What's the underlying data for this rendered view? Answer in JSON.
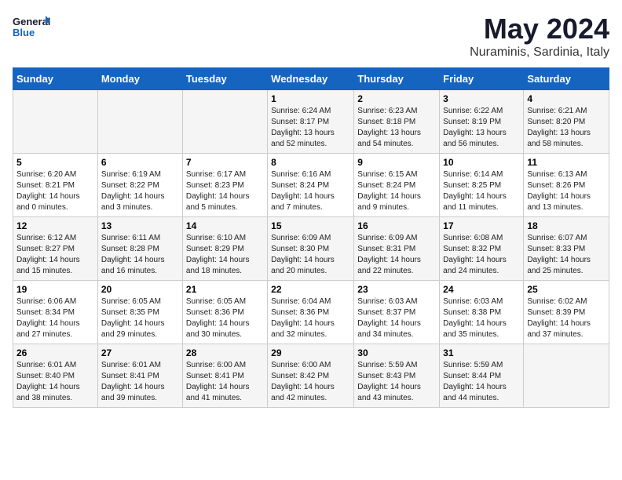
{
  "header": {
    "logo_line1": "General",
    "logo_line2": "Blue",
    "month": "May 2024",
    "location": "Nuraminis, Sardinia, Italy"
  },
  "weekdays": [
    "Sunday",
    "Monday",
    "Tuesday",
    "Wednesday",
    "Thursday",
    "Friday",
    "Saturday"
  ],
  "weeks": [
    [
      {
        "day": "",
        "info": ""
      },
      {
        "day": "",
        "info": ""
      },
      {
        "day": "",
        "info": ""
      },
      {
        "day": "1",
        "info": "Sunrise: 6:24 AM\nSunset: 8:17 PM\nDaylight: 13 hours\nand 52 minutes."
      },
      {
        "day": "2",
        "info": "Sunrise: 6:23 AM\nSunset: 8:18 PM\nDaylight: 13 hours\nand 54 minutes."
      },
      {
        "day": "3",
        "info": "Sunrise: 6:22 AM\nSunset: 8:19 PM\nDaylight: 13 hours\nand 56 minutes."
      },
      {
        "day": "4",
        "info": "Sunrise: 6:21 AM\nSunset: 8:20 PM\nDaylight: 13 hours\nand 58 minutes."
      }
    ],
    [
      {
        "day": "5",
        "info": "Sunrise: 6:20 AM\nSunset: 8:21 PM\nDaylight: 14 hours\nand 0 minutes."
      },
      {
        "day": "6",
        "info": "Sunrise: 6:19 AM\nSunset: 8:22 PM\nDaylight: 14 hours\nand 3 minutes."
      },
      {
        "day": "7",
        "info": "Sunrise: 6:17 AM\nSunset: 8:23 PM\nDaylight: 14 hours\nand 5 minutes."
      },
      {
        "day": "8",
        "info": "Sunrise: 6:16 AM\nSunset: 8:24 PM\nDaylight: 14 hours\nand 7 minutes."
      },
      {
        "day": "9",
        "info": "Sunrise: 6:15 AM\nSunset: 8:24 PM\nDaylight: 14 hours\nand 9 minutes."
      },
      {
        "day": "10",
        "info": "Sunrise: 6:14 AM\nSunset: 8:25 PM\nDaylight: 14 hours\nand 11 minutes."
      },
      {
        "day": "11",
        "info": "Sunrise: 6:13 AM\nSunset: 8:26 PM\nDaylight: 14 hours\nand 13 minutes."
      }
    ],
    [
      {
        "day": "12",
        "info": "Sunrise: 6:12 AM\nSunset: 8:27 PM\nDaylight: 14 hours\nand 15 minutes."
      },
      {
        "day": "13",
        "info": "Sunrise: 6:11 AM\nSunset: 8:28 PM\nDaylight: 14 hours\nand 16 minutes."
      },
      {
        "day": "14",
        "info": "Sunrise: 6:10 AM\nSunset: 8:29 PM\nDaylight: 14 hours\nand 18 minutes."
      },
      {
        "day": "15",
        "info": "Sunrise: 6:09 AM\nSunset: 8:30 PM\nDaylight: 14 hours\nand 20 minutes."
      },
      {
        "day": "16",
        "info": "Sunrise: 6:09 AM\nSunset: 8:31 PM\nDaylight: 14 hours\nand 22 minutes."
      },
      {
        "day": "17",
        "info": "Sunrise: 6:08 AM\nSunset: 8:32 PM\nDaylight: 14 hours\nand 24 minutes."
      },
      {
        "day": "18",
        "info": "Sunrise: 6:07 AM\nSunset: 8:33 PM\nDaylight: 14 hours\nand 25 minutes."
      }
    ],
    [
      {
        "day": "19",
        "info": "Sunrise: 6:06 AM\nSunset: 8:34 PM\nDaylight: 14 hours\nand 27 minutes."
      },
      {
        "day": "20",
        "info": "Sunrise: 6:05 AM\nSunset: 8:35 PM\nDaylight: 14 hours\nand 29 minutes."
      },
      {
        "day": "21",
        "info": "Sunrise: 6:05 AM\nSunset: 8:36 PM\nDaylight: 14 hours\nand 30 minutes."
      },
      {
        "day": "22",
        "info": "Sunrise: 6:04 AM\nSunset: 8:36 PM\nDaylight: 14 hours\nand 32 minutes."
      },
      {
        "day": "23",
        "info": "Sunrise: 6:03 AM\nSunset: 8:37 PM\nDaylight: 14 hours\nand 34 minutes."
      },
      {
        "day": "24",
        "info": "Sunrise: 6:03 AM\nSunset: 8:38 PM\nDaylight: 14 hours\nand 35 minutes."
      },
      {
        "day": "25",
        "info": "Sunrise: 6:02 AM\nSunset: 8:39 PM\nDaylight: 14 hours\nand 37 minutes."
      }
    ],
    [
      {
        "day": "26",
        "info": "Sunrise: 6:01 AM\nSunset: 8:40 PM\nDaylight: 14 hours\nand 38 minutes."
      },
      {
        "day": "27",
        "info": "Sunrise: 6:01 AM\nSunset: 8:41 PM\nDaylight: 14 hours\nand 39 minutes."
      },
      {
        "day": "28",
        "info": "Sunrise: 6:00 AM\nSunset: 8:41 PM\nDaylight: 14 hours\nand 41 minutes."
      },
      {
        "day": "29",
        "info": "Sunrise: 6:00 AM\nSunset: 8:42 PM\nDaylight: 14 hours\nand 42 minutes."
      },
      {
        "day": "30",
        "info": "Sunrise: 5:59 AM\nSunset: 8:43 PM\nDaylight: 14 hours\nand 43 minutes."
      },
      {
        "day": "31",
        "info": "Sunrise: 5:59 AM\nSunset: 8:44 PM\nDaylight: 14 hours\nand 44 minutes."
      },
      {
        "day": "",
        "info": ""
      }
    ]
  ]
}
